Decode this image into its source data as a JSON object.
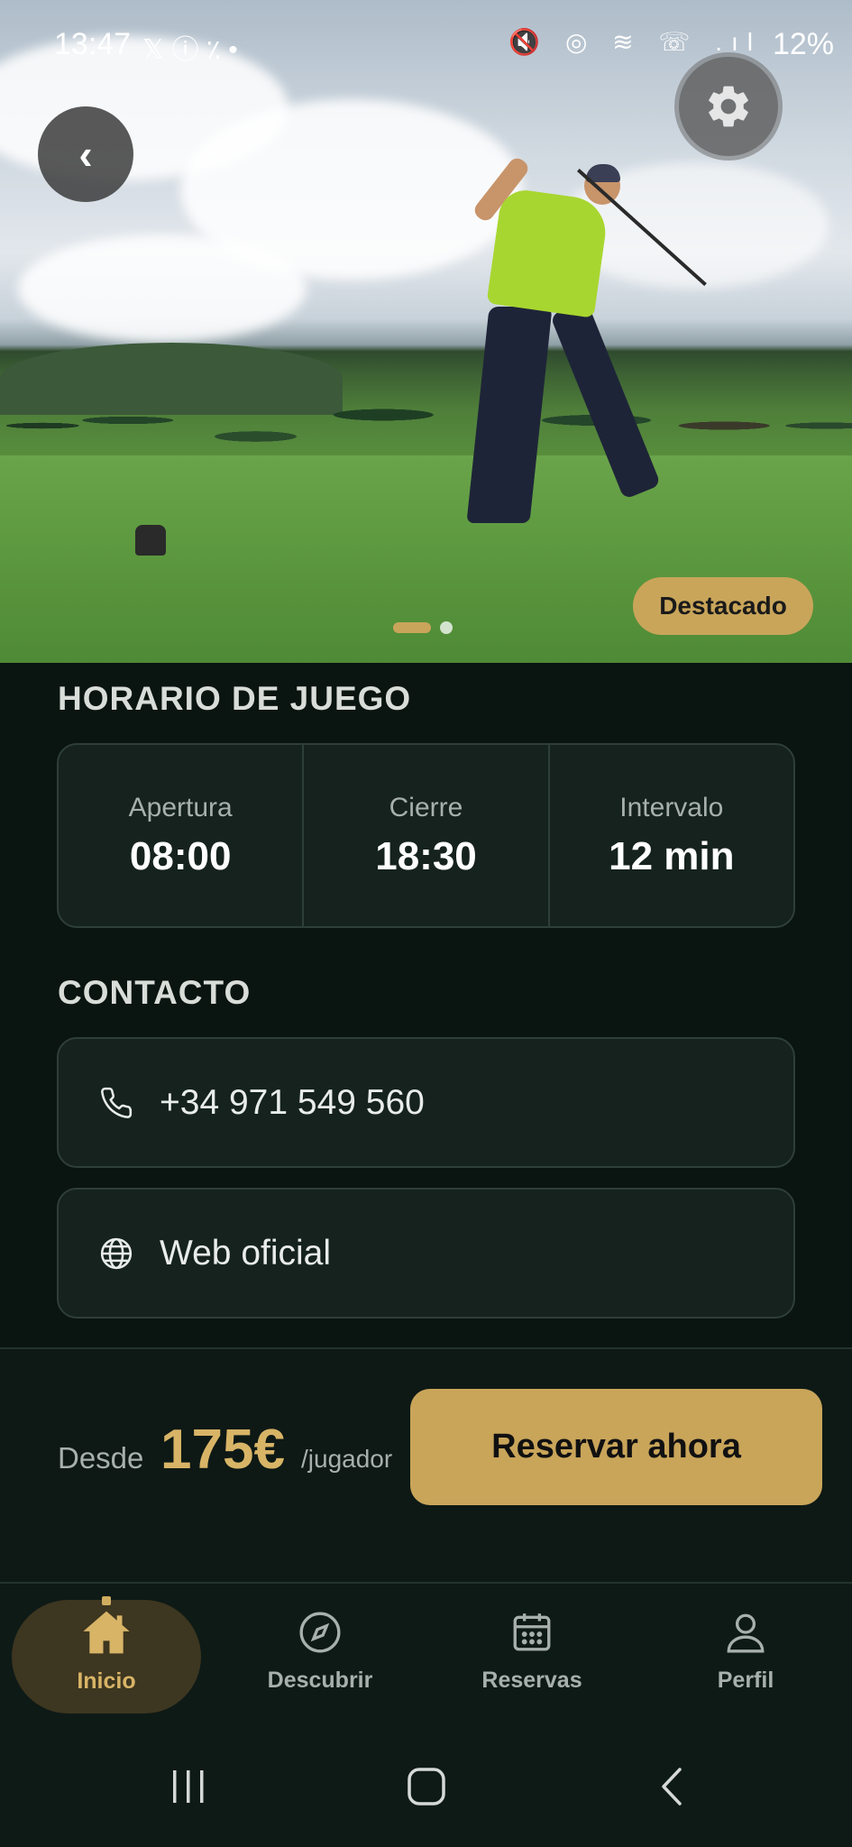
{
  "status_bar": {
    "time": "13:47",
    "left_icons": "𝕏 ⓘ ٪ •",
    "right_icons": "🔇 ◎ ≋ ☏ .ıl",
    "battery": "12%"
  },
  "hero": {
    "badge": "Destacado",
    "slides_total": 2,
    "slide_active": 1
  },
  "schedule": {
    "title": "HORARIO DE JUEGO",
    "items": [
      {
        "label": "Apertura",
        "value": "08:00"
      },
      {
        "label": "Cierre",
        "value": "18:30"
      },
      {
        "label": "Intervalo",
        "value": "12 min"
      }
    ]
  },
  "contact": {
    "title": "CONTACTO",
    "phone": "+34 971 549 560",
    "website": "Web oficial"
  },
  "booking": {
    "from_label": "Desde",
    "price": "175€",
    "unit": "/jugador",
    "button": "Reservar ahora"
  },
  "nav": {
    "items": [
      {
        "label": "Inicio",
        "icon": "home-icon",
        "active": true
      },
      {
        "label": "Descubrir",
        "icon": "compass-icon",
        "active": false
      },
      {
        "label": "Reservas",
        "icon": "calendar-icon",
        "active": false
      },
      {
        "label": "Perfil",
        "icon": "user-icon",
        "active": false
      }
    ]
  },
  "colors": {
    "accent": "#c9a55a",
    "background": "#0a1410",
    "card": "#15221e"
  }
}
